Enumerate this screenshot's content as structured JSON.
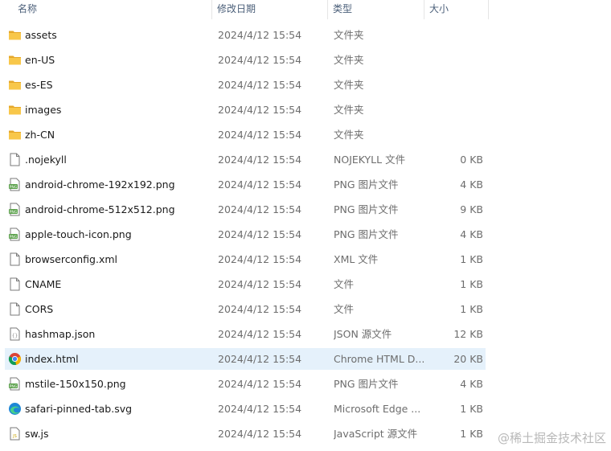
{
  "columns": {
    "name": "名称",
    "date": "修改日期",
    "type": "类型",
    "size": "大小"
  },
  "files": [
    {
      "name": "assets",
      "date": "2024/4/12 15:54",
      "type": "文件夹",
      "size": "",
      "icon": "folder-icon"
    },
    {
      "name": "en-US",
      "date": "2024/4/12 15:54",
      "type": "文件夹",
      "size": "",
      "icon": "folder-icon"
    },
    {
      "name": "es-ES",
      "date": "2024/4/12 15:54",
      "type": "文件夹",
      "size": "",
      "icon": "folder-icon"
    },
    {
      "name": "images",
      "date": "2024/4/12 15:54",
      "type": "文件夹",
      "size": "",
      "icon": "folder-icon"
    },
    {
      "name": "zh-CN",
      "date": "2024/4/12 15:54",
      "type": "文件夹",
      "size": "",
      "icon": "folder-icon"
    },
    {
      "name": ".nojekyll",
      "date": "2024/4/12 15:54",
      "type": "NOJEKYLL 文件",
      "size": "0 KB",
      "icon": "blank-file-icon"
    },
    {
      "name": "android-chrome-192x192.png",
      "date": "2024/4/12 15:54",
      "type": "PNG 图片文件",
      "size": "4 KB",
      "icon": "png-file-icon"
    },
    {
      "name": "android-chrome-512x512.png",
      "date": "2024/4/12 15:54",
      "type": "PNG 图片文件",
      "size": "9 KB",
      "icon": "png-file-icon"
    },
    {
      "name": "apple-touch-icon.png",
      "date": "2024/4/12 15:54",
      "type": "PNG 图片文件",
      "size": "4 KB",
      "icon": "png-file-icon"
    },
    {
      "name": "browserconfig.xml",
      "date": "2024/4/12 15:54",
      "type": "XML 文件",
      "size": "1 KB",
      "icon": "blank-file-icon"
    },
    {
      "name": "CNAME",
      "date": "2024/4/12 15:54",
      "type": "文件",
      "size": "1 KB",
      "icon": "blank-file-icon"
    },
    {
      "name": "CORS",
      "date": "2024/4/12 15:54",
      "type": "文件",
      "size": "1 KB",
      "icon": "blank-file-icon"
    },
    {
      "name": "hashmap.json",
      "date": "2024/4/12 15:54",
      "type": "JSON 源文件",
      "size": "12 KB",
      "icon": "json-file-icon"
    },
    {
      "name": "index.html",
      "date": "2024/4/12 15:54",
      "type": "Chrome HTML D...",
      "size": "20 KB",
      "icon": "chrome-icon",
      "selected": true
    },
    {
      "name": "mstile-150x150.png",
      "date": "2024/4/12 15:54",
      "type": "PNG 图片文件",
      "size": "4 KB",
      "icon": "png-file-icon"
    },
    {
      "name": "safari-pinned-tab.svg",
      "date": "2024/4/12 15:54",
      "type": "Microsoft Edge ...",
      "size": "1 KB",
      "icon": "edge-icon"
    },
    {
      "name": "sw.js",
      "date": "2024/4/12 15:54",
      "type": "JavaScript 源文件",
      "size": "1 KB",
      "icon": "js-file-icon"
    }
  ],
  "watermark": "@稀土掘金技术社区",
  "colors": {
    "folder": "#f8c74a",
    "folder_dark": "#e5a72a",
    "selected_bg": "#e5f1fb",
    "header_text": "#4c607a",
    "secondary_text": "#6d6d6d"
  }
}
